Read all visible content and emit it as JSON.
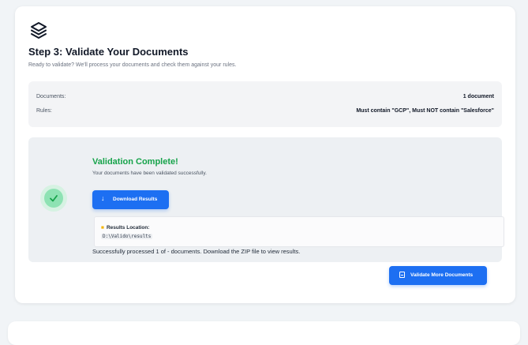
{
  "header": {
    "logo_icon": "layers-icon",
    "title": "Step 3: Validate Your Documents",
    "subtitle": "Ready to validate? We'll process your documents and check them against your rules."
  },
  "summary": {
    "documents_label": "Documents:",
    "documents_value": "1 document",
    "rules_label": "Rules:",
    "rules_value": "Must contain \"GCP\", Must NOT contain \"Salesforce\""
  },
  "result": {
    "status_icon": "check-circle-icon",
    "title": "Validation Complete!",
    "subtitle": "Your documents have been validated successfully.",
    "download_icon": "download-arrow-icon",
    "download_label": "Download Results",
    "location_icon": "folder-icon",
    "location_label": "Results Location:",
    "location_path": "D:\\Valido\\results",
    "message": "Successfully processed 1 of - documents. Download the ZIP file to view results."
  },
  "actions": {
    "validate_more_icon": "document-icon",
    "validate_more_label": "Validate More Documents"
  },
  "colors": {
    "accent": "#1d6ff2",
    "success": "#16a34a",
    "success_soft": "#8ee2b3"
  }
}
